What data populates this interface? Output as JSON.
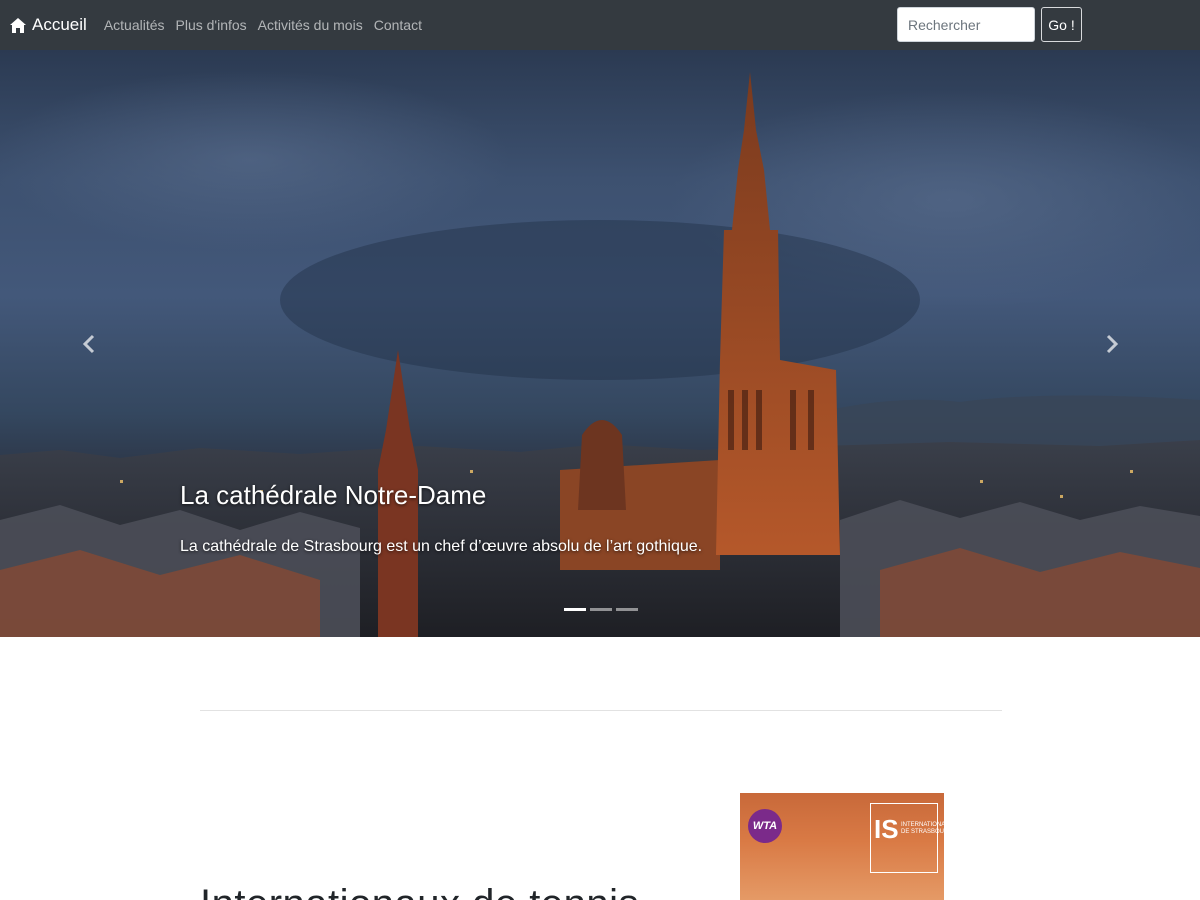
{
  "navbar": {
    "brand_label": "Accueil",
    "links": [
      "Actualités",
      "Plus d'infos",
      "Activités du mois",
      "Contact"
    ],
    "search_placeholder": "Rechercher",
    "go_label": "Go !"
  },
  "carousel": {
    "caption_title": "La cathédrale Notre-Dame",
    "caption_text": "La cathédrale de Strasbourg est un chef d’œuvre absolu de l’art gothique.",
    "slide_count": 3,
    "active_slide": 1
  },
  "featurette": {
    "heading": "Internationaux de tennis"
  },
  "poster": {
    "badge": "WTA",
    "logo_mark": "IS",
    "logo_text": "Internationaux de Strasbourg"
  },
  "colors": {
    "navbar_bg": "#343a40",
    "poster_bg": "#d97a45",
    "wta_purple": "#7b2a8a"
  }
}
